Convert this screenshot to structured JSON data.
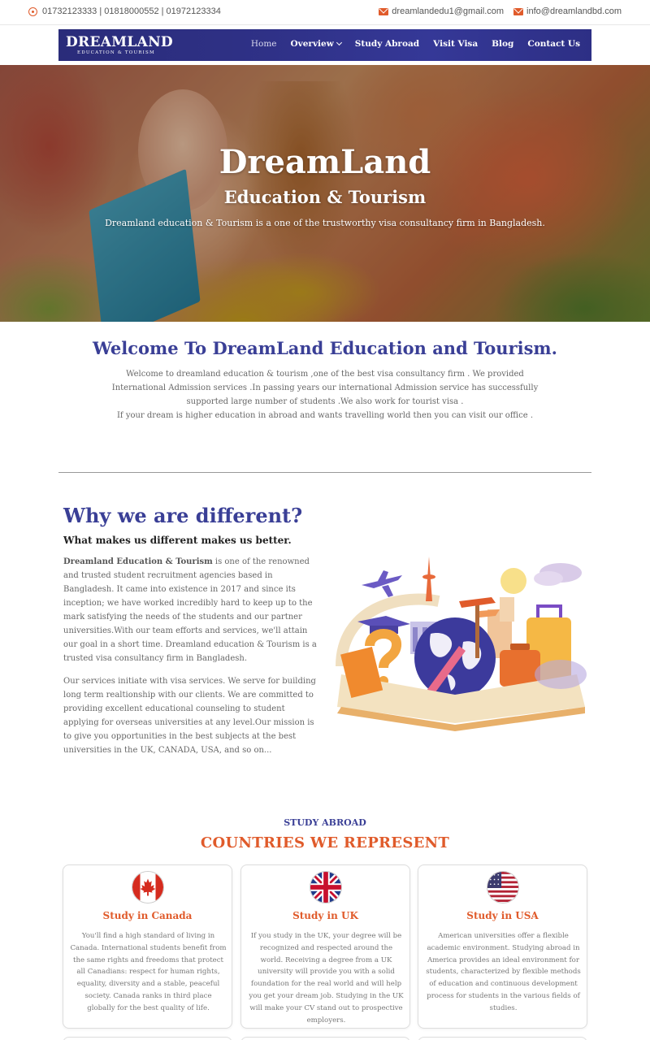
{
  "topbar": {
    "phones": "01732123333 | 01818000552 | 01972123334",
    "email1": "dreamlandedu1@gmail.com",
    "email2": "info@dreamlandbd.com"
  },
  "nav": {
    "logo_main": "DREAMLAND",
    "logo_sub": "EDUCATION & TOURISM",
    "items": [
      {
        "label": "Home"
      },
      {
        "label": "Overview"
      },
      {
        "label": "Study Abroad"
      },
      {
        "label": "Visit Visa"
      },
      {
        "label": "Blog"
      },
      {
        "label": "Contact Us"
      }
    ]
  },
  "hero": {
    "title": "DreamLand",
    "subtitle": "Education & Tourism",
    "description": "Dreamland education & Tourism is a one of the trustworthy  visa consultancy firm in Bangladesh."
  },
  "welcome": {
    "title": "Welcome To DreamLand Education and Tourism.",
    "line1": "Welcome to dreamland education & tourism ,one of the best visa consultancy firm . We provided International Admission services .In passing years our international Admission service has successfully supported large number of students .We also work for tourist visa .",
    "line2": "If your dream is higher education in abroad and wants travelling world then you can visit our office ."
  },
  "why": {
    "title": "Why we are different?",
    "subtitle": "What makes us different makes us better.",
    "p1_bold": "Dreamland Education & Tourism",
    "p1_rest": " is one of the renowned and trusted student recruitment agencies based in Bangladesh. It came into existence in 2017 and since its inception; we have worked incredibly hard to keep up to the mark satisfying the needs of the students and our partner universities.With our team efforts and services, we'll attain our goal in a short time. Dreamland education & Tourism is a trusted visa consultancy firm in Bangladesh.",
    "p2": "Our services initiate with visa services. We serve for building long term realtionship with our clients. We are committed to providing excellent educational counseling to student applying for overseas universities at any level.Our mission is to give you opportunities in the best subjects at the best universities in the UK, CANADA, USA, and so on..."
  },
  "study_abroad": {
    "label": "STUDY ABROAD",
    "title": "COUNTRIES WE REPRESENT",
    "cards": [
      {
        "title": "Study in Canada",
        "flag": "canada-flag",
        "text": "You'll find a high standard of living in Canada. International students benefit from the same rights and freedoms that protect all Canadians: respect for human rights, equality, diversity and a stable, peaceful society. Canada ranks in third place globally for the best quality of life."
      },
      {
        "title": "Study in UK",
        "flag": "uk-flag",
        "text": "If you study in the UK, your degree will be recognized and respected around the world. Receiving a degree from a UK university will provide you with a solid foundation for the real world and will help you get your dream job. Studying in the UK will make your CV stand out to prospective employers."
      },
      {
        "title": "Study in USA",
        "flag": "usa-flag",
        "text": "American universities offer a flexible academic environment. Studying abroad in America provides an ideal environment for students, characterized by flexible methods of education and continuous development process for students in the various fields of studies."
      }
    ]
  },
  "colors": {
    "brand_blue": "#3a3f96",
    "accent_orange": "#e05b2b",
    "nav_bg": "#2f3187"
  }
}
